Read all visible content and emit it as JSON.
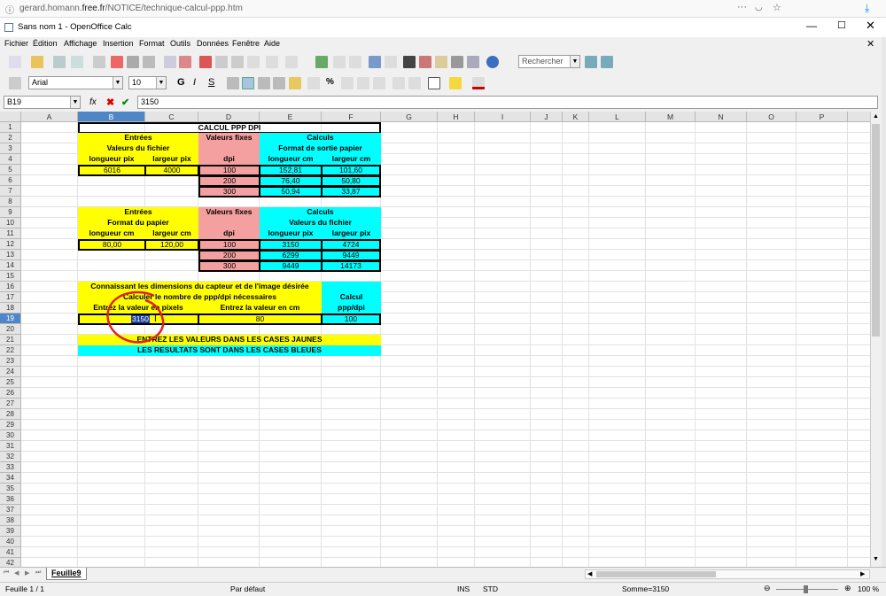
{
  "browser": {
    "url_prefix": "gerard.homann.",
    "url_domain": "free.fr",
    "url_path": "/NOTICE/technique-calcul-ppp.htm"
  },
  "window": {
    "title": "Sans nom 1 - OpenOffice Calc"
  },
  "menu": [
    "Fichier",
    "Édition",
    "Affichage",
    "Insertion",
    "Format",
    "Outils",
    "Données",
    "Fenêtre",
    "Aide"
  ],
  "toolbar": {
    "search_placeholder": "Rechercher",
    "font_name": "Arial",
    "font_size": "10"
  },
  "formula": {
    "cell_ref": "B19",
    "content": "3150",
    "fx_label": "fx"
  },
  "columns": [
    "A",
    "B",
    "C",
    "D",
    "E",
    "F",
    "G",
    "H",
    "I",
    "J",
    "K",
    "L",
    "M",
    "N",
    "O",
    "P"
  ],
  "rows": [
    "1",
    "2",
    "3",
    "4",
    "5",
    "6",
    "7",
    "8",
    "9",
    "10",
    "11",
    "12",
    "13",
    "14",
    "15",
    "16",
    "17",
    "18",
    "19",
    "20",
    "21",
    "22",
    "23",
    "24",
    "25",
    "26",
    "27",
    "28",
    "29",
    "30",
    "31",
    "32",
    "33",
    "34",
    "35",
    "36",
    "37",
    "38",
    "39",
    "40",
    "41",
    "42"
  ],
  "sheet": {
    "title": "CALCUL PPP DPI",
    "t1": {
      "entrees": "Entrées",
      "valeurs_fichier": "Valeurs du fichier",
      "longueur": "longueur pix",
      "largeur": "largeur pix",
      "valeurs_fixes": "Valeurs fixes",
      "dpi": "dpi",
      "calculs": "Calculs",
      "format_sortie": "Format de sortie papier",
      "longueur_cm": "longueur cm",
      "largeur_cm": "largeur cm",
      "in_long": "6016",
      "in_larg": "4000",
      "rows": [
        {
          "dpi": "100",
          "a": "152,81",
          "b": "101,60"
        },
        {
          "dpi": "200",
          "a": "76,40",
          "b": "50,80"
        },
        {
          "dpi": "300",
          "a": "50,94",
          "b": "33,87"
        }
      ]
    },
    "t2": {
      "entrees": "Entrées",
      "format_papier": "Format du papier",
      "longueur": "longueur cm",
      "largeur": "largeur cm",
      "valeurs_fixes": "Valeurs fixes",
      "dpi": "dpi",
      "calculs": "Calculs",
      "valeurs_fichier": "Valeurs du fichier",
      "longueur_pix": "longueur pix",
      "largeur_pix": "largeur pix",
      "in_long": "80,00",
      "in_larg": "120,00",
      "rows": [
        {
          "dpi": "100",
          "a": "3150",
          "b": "4724"
        },
        {
          "dpi": "200",
          "a": "6299",
          "b": "9449"
        },
        {
          "dpi": "300",
          "a": "9449",
          "b": "14173"
        }
      ]
    },
    "t3": {
      "line1": "Connaissant les dimensions du capteur et de l'image désirée",
      "line2": "Calculer le nombre de ppp/dpi nécessaires",
      "calcul": "Calcul",
      "pppdpi": "ppp/dpi",
      "entrez_pixels": "Entrez la valeur en pixels",
      "entrez_cm": "Entrez la valeur en cm",
      "val_pix": "3150",
      "val_cm": "80",
      "result": "100"
    },
    "note_jaune": "ENTREZ LES VALEURS DANS LES CASES JAUNES",
    "note_bleue": "LES RESULTATS SONT DANS LES CASES BLEUES"
  },
  "tab": {
    "name": "Feuille9"
  },
  "status": {
    "sheet": "Feuille 1 / 1",
    "style": "Par défaut",
    "ins": "INS",
    "std": "STD",
    "sum": "Somme=3150",
    "zoom": "100 %"
  },
  "colors": {
    "yellow": "#ffff00",
    "pink": "#f4a0a0",
    "cyan": "#00ffff",
    "annotation_red": "#e02020"
  }
}
